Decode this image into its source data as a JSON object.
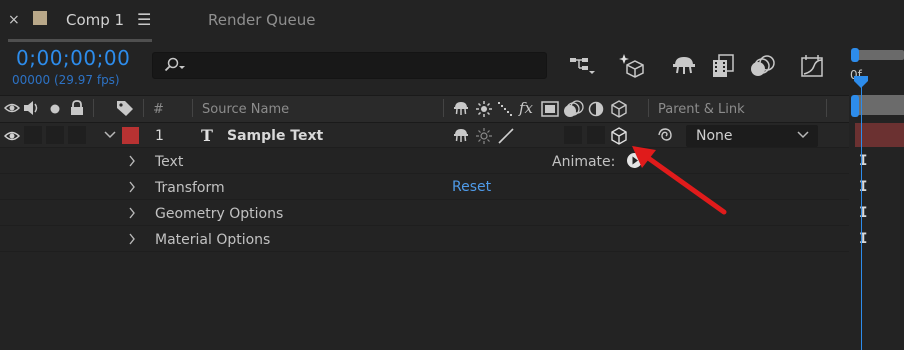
{
  "tabs": {
    "active": {
      "label": "Comp 1",
      "close_glyph": "×",
      "menu_glyph": "☰",
      "swatch_color": "#b9a889"
    },
    "inactive": {
      "label": "Render Queue"
    }
  },
  "timecode": {
    "value": "0;00;00;00",
    "frames": "00000 (29.97 fps)"
  },
  "search": {
    "placeholder": "",
    "icon": "search-icon"
  },
  "toolbar": [
    "comp-flowchart-icon",
    "draft-3d-icon",
    "hide-shy-icon",
    "frame-blending-icon",
    "motion-blur-icon",
    "graph-editor-icon"
  ],
  "ruler": {
    "label": "0f"
  },
  "columns": {
    "number": "#",
    "source_name": "Source Name",
    "parent_link": "Parent & Link"
  },
  "layer": {
    "number": "1",
    "type_glyph": "T",
    "name": "Sample Text",
    "label_color": "#b83232",
    "parent": "None"
  },
  "properties": [
    {
      "label": "Text"
    },
    {
      "label": "Transform"
    },
    {
      "label": "Geometry Options"
    },
    {
      "label": "Material Options"
    }
  ],
  "animate": {
    "label": "Animate:"
  },
  "transform_reset": "Reset",
  "annotation_color": "#e01b1b"
}
